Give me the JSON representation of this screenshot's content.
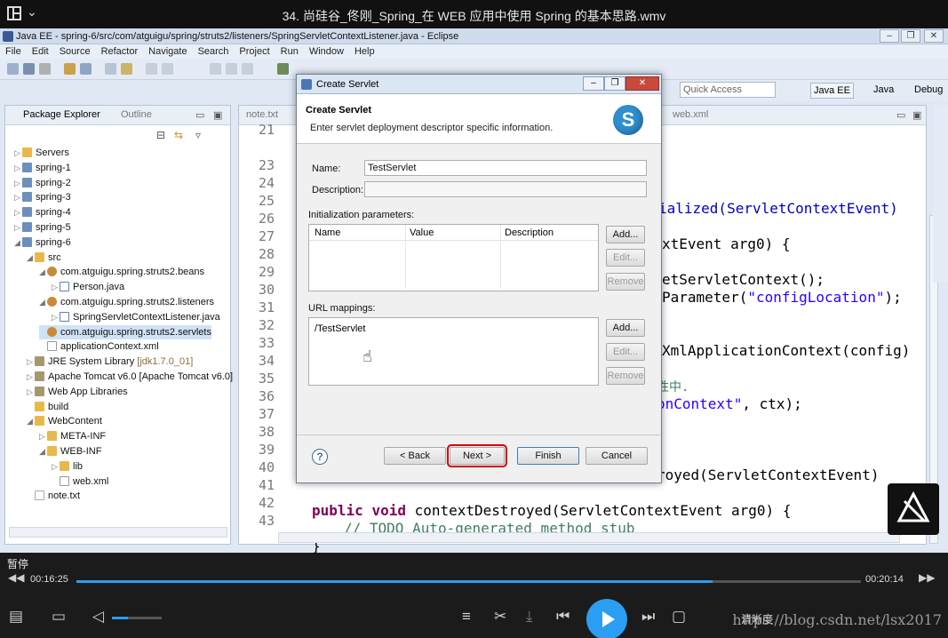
{
  "player": {
    "video_title": "34. 尚硅谷_佟刚_Spring_在 WEB 应用中使用 Spring 的基本思路.wmv",
    "status_label": "暂停",
    "time_current": "00:16:25",
    "time_total": "00:20:14",
    "progress_fraction": 0.811,
    "volume_fraction": 0.32,
    "quality_label": "清晰度",
    "watermark_url": "https://blog.csdn.net/lsx2017",
    "accent_color": "#2a9ef2"
  },
  "eclipse": {
    "window_title": "Java EE - spring-6/src/com/atguigu/spring/struts2/listeners/SpringServletContextListener.java - Eclipse",
    "menu": [
      "File",
      "Edit",
      "Source",
      "Refactor",
      "Navigate",
      "Search",
      "Project",
      "Run",
      "Window",
      "Help"
    ],
    "quick_access_placeholder": "Quick Access",
    "perspectives": [
      "Java EE",
      "Java",
      "Debug"
    ]
  },
  "package_explorer": {
    "tab_label": "Package Explorer",
    "outline_tab_label": "Outline",
    "tree": [
      {
        "label": "Servers",
        "icon": "folder",
        "twisty": "▷",
        "depth": 0
      },
      {
        "label": "spring-1",
        "icon": "proj",
        "twisty": "▷",
        "depth": 0
      },
      {
        "label": "spring-2",
        "icon": "proj",
        "twisty": "▷",
        "depth": 0
      },
      {
        "label": "spring-3",
        "icon": "proj",
        "twisty": "▷",
        "depth": 0
      },
      {
        "label": "spring-4",
        "icon": "proj",
        "twisty": "▷",
        "depth": 0
      },
      {
        "label": "spring-5",
        "icon": "proj",
        "twisty": "▷",
        "depth": 0
      },
      {
        "label": "spring-6",
        "icon": "proj",
        "twisty": "◢",
        "depth": 0
      },
      {
        "label": "src",
        "icon": "folder",
        "twisty": "◢",
        "depth": 1
      },
      {
        "label": "com.atguigu.spring.struts2.beans",
        "icon": "pkg",
        "twisty": "◢",
        "depth": 2
      },
      {
        "label": "Person.java",
        "icon": "java",
        "twisty": "▷",
        "depth": 3
      },
      {
        "label": "com.atguigu.spring.struts2.listeners",
        "icon": "pkg",
        "twisty": "◢",
        "depth": 2
      },
      {
        "label": "SpringServletContextListener.java",
        "icon": "java",
        "twisty": "▷",
        "depth": 3
      },
      {
        "label": "com.atguigu.spring.struts2.servlets",
        "icon": "pkg",
        "twisty": "",
        "depth": 2,
        "selected": true
      },
      {
        "label": "applicationContext.xml",
        "icon": "xml",
        "twisty": "",
        "depth": 2
      },
      {
        "label": "JRE System Library",
        "sub": "[jdk1.7.0_01]",
        "icon": "lib",
        "twisty": "▷",
        "depth": 1
      },
      {
        "label": "Apache Tomcat v6.0 [Apache Tomcat v6.0]",
        "icon": "lib",
        "twisty": "▷",
        "depth": 1
      },
      {
        "label": "Web App Libraries",
        "icon": "lib",
        "twisty": "▷",
        "depth": 1
      },
      {
        "label": "build",
        "icon": "folder",
        "twisty": "",
        "depth": 1
      },
      {
        "label": "WebContent",
        "icon": "folder",
        "twisty": "◢",
        "depth": 1
      },
      {
        "label": "META-INF",
        "icon": "folder",
        "twisty": "▷",
        "depth": 2
      },
      {
        "label": "WEB-INF",
        "icon": "folder",
        "twisty": "◢",
        "depth": 2
      },
      {
        "label": "lib",
        "icon": "folder",
        "twisty": "▷",
        "depth": 3
      },
      {
        "label": "web.xml",
        "icon": "xml",
        "twisty": "",
        "depth": 3
      },
      {
        "label": "note.txt",
        "icon": "txt",
        "twisty": "",
        "depth": 1
      }
    ]
  },
  "editor": {
    "tabs": [
      "note.txt",
      "web.xml"
    ],
    "line_numbers": [
      "21",
      "23",
      "24",
      "25",
      "26",
      "27",
      "28",
      "29",
      "30",
      "31",
      "32",
      "33",
      "34",
      "35",
      "36",
      "37",
      "38",
      "39",
      "40",
      "41",
      "42",
      "43"
    ],
    "visible_fragments": [
      "ialized(ServletContextEvent)",
      "xtEvent arg0) {",
      "etServletContext();",
      "Parameter(\"configLocation\");",
      "XmlApplicationContext(config)",
      "性中.",
      "onContext\", ctx);",
      "royed(ServletContextEvent)",
      "public void contextDestroyed(ServletContextEvent arg0) {",
      "// TODO Auto-generated method stub",
      "}"
    ]
  },
  "dialog": {
    "window_title": "Create Servlet",
    "header_title": "Create Servlet",
    "header_description": "Enter servlet deployment descriptor specific information.",
    "logo_letter": "S",
    "name_label": "Name:",
    "name_value": "TestServlet",
    "description_label": "Description:",
    "description_value": "",
    "init_params_label": "Initialization parameters:",
    "init_params_columns": [
      "Name",
      "Value",
      "Description"
    ],
    "url_mappings_label": "URL mappings:",
    "url_mappings": [
      "/TestServlet"
    ],
    "add_label": "Add...",
    "edit_label": "Edit...",
    "remove_label": "Remove",
    "help_label": "?",
    "back_label": "< Back",
    "next_label": "Next >",
    "finish_label": "Finish",
    "cancel_label": "Cancel"
  }
}
